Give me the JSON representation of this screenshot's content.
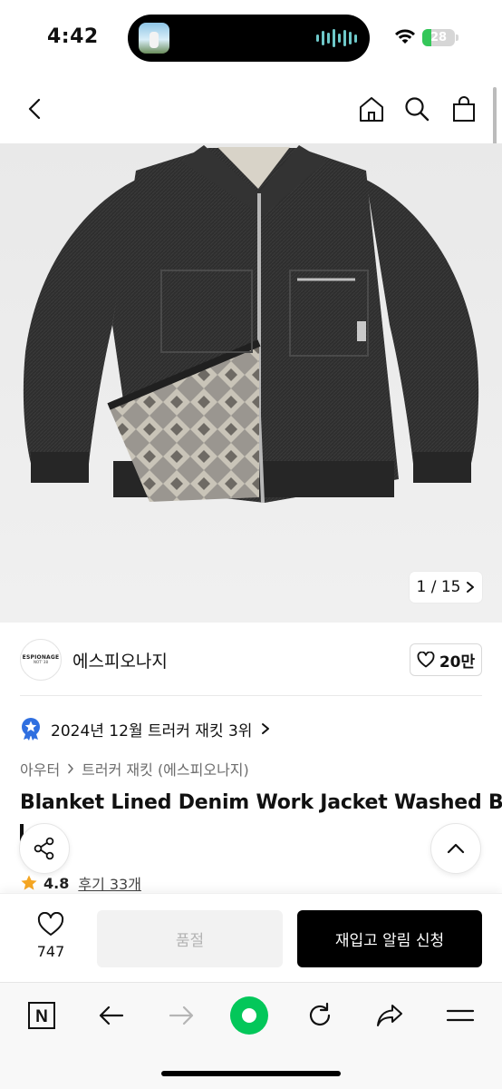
{
  "status_bar": {
    "time": "4:42",
    "battery": "28",
    "battery_level": 0.28,
    "icons": [
      "music-wave-icon",
      "wifi-icon",
      "battery-icon"
    ]
  },
  "top_nav": {
    "icons": [
      "back-icon",
      "home-icon",
      "search-icon",
      "shopping-bag-icon"
    ]
  },
  "gallery": {
    "image_desc": "product-photo-denim-jacket",
    "current": "1",
    "total": "15",
    "counter_text": "1 / 15"
  },
  "brand": {
    "logo_text": "ESPIONAGE",
    "logo_sub": "NOT' 38",
    "name": "에스피오나지",
    "likes": "20만"
  },
  "ranking": {
    "text": "2024년 12월 트러커 재킷 3위"
  },
  "breadcrumb": {
    "category": "아우터",
    "subcategory": "트러커 재킷 (에스피오나지)"
  },
  "product": {
    "title": "Blanket Lined Denim Work Jacket Washed B",
    "rating": "4.8",
    "reviews": "후기 33개"
  },
  "purchase": {
    "wish_count": "747",
    "soldout_label": "품절",
    "notify_label": "재입고 알림 신청"
  },
  "browser": {
    "n_label": "N",
    "icons": [
      "n-home-icon",
      "back-arrow-icon",
      "forward-arrow-icon",
      "green-dot-icon",
      "reload-icon",
      "share-icon",
      "menu-icon"
    ]
  },
  "colors": {
    "accent_black": "#000000",
    "battery_green": "#34c759",
    "browser_green": "#03c75a",
    "badge_blue": "#2f6fe0",
    "star_orange": "#f5a623"
  }
}
